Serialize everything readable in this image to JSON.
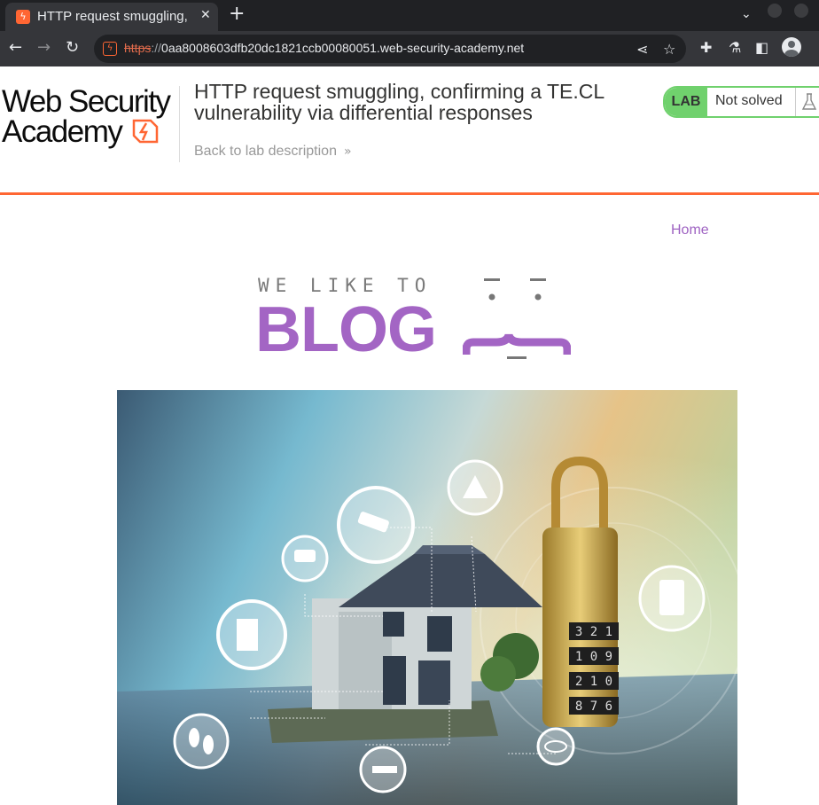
{
  "browser": {
    "tab_title": "HTTP request smuggling, c",
    "tab_close": "✕",
    "new_tab": "+",
    "url_scheme": "https",
    "url_sep": "://",
    "url_host": "0aa8008603dfb20dc1821ccb00080051.web-security-academy.net"
  },
  "header": {
    "logo_line1": "Web Security",
    "logo_line2": "Academy",
    "lab_title": "HTTP request smuggling, confirming a TE.CL vulnerability via differential responses",
    "back_link": "Back to lab description",
    "lab_badge": "LAB",
    "lab_status": "Not solved"
  },
  "nav": {
    "home": "Home"
  },
  "blog": {
    "tagline": "WE LIKE TO",
    "title": "BLOG"
  },
  "hero": {
    "code_rows": [
      "3 2 1",
      "1 0 9",
      "2 1 0",
      "8 7 6"
    ]
  },
  "colors": {
    "academy_orange": "#ff6633",
    "lab_green": "#70d16d",
    "blog_purple": "#a365c4",
    "chrome_dark": "#202124",
    "chrome_toolbar": "#35363a"
  },
  "icons": [
    "favicon-icon",
    "close-icon",
    "plus-icon",
    "chevron-down-icon",
    "back-arrow-icon",
    "forward-arrow-icon",
    "reload-icon",
    "not-secure-icon",
    "share-icon",
    "star-icon",
    "extensions-icon",
    "labs-flask-icon",
    "side-panel-icon",
    "profile-icon",
    "double-chevron-right-icon",
    "flask-icon"
  ]
}
